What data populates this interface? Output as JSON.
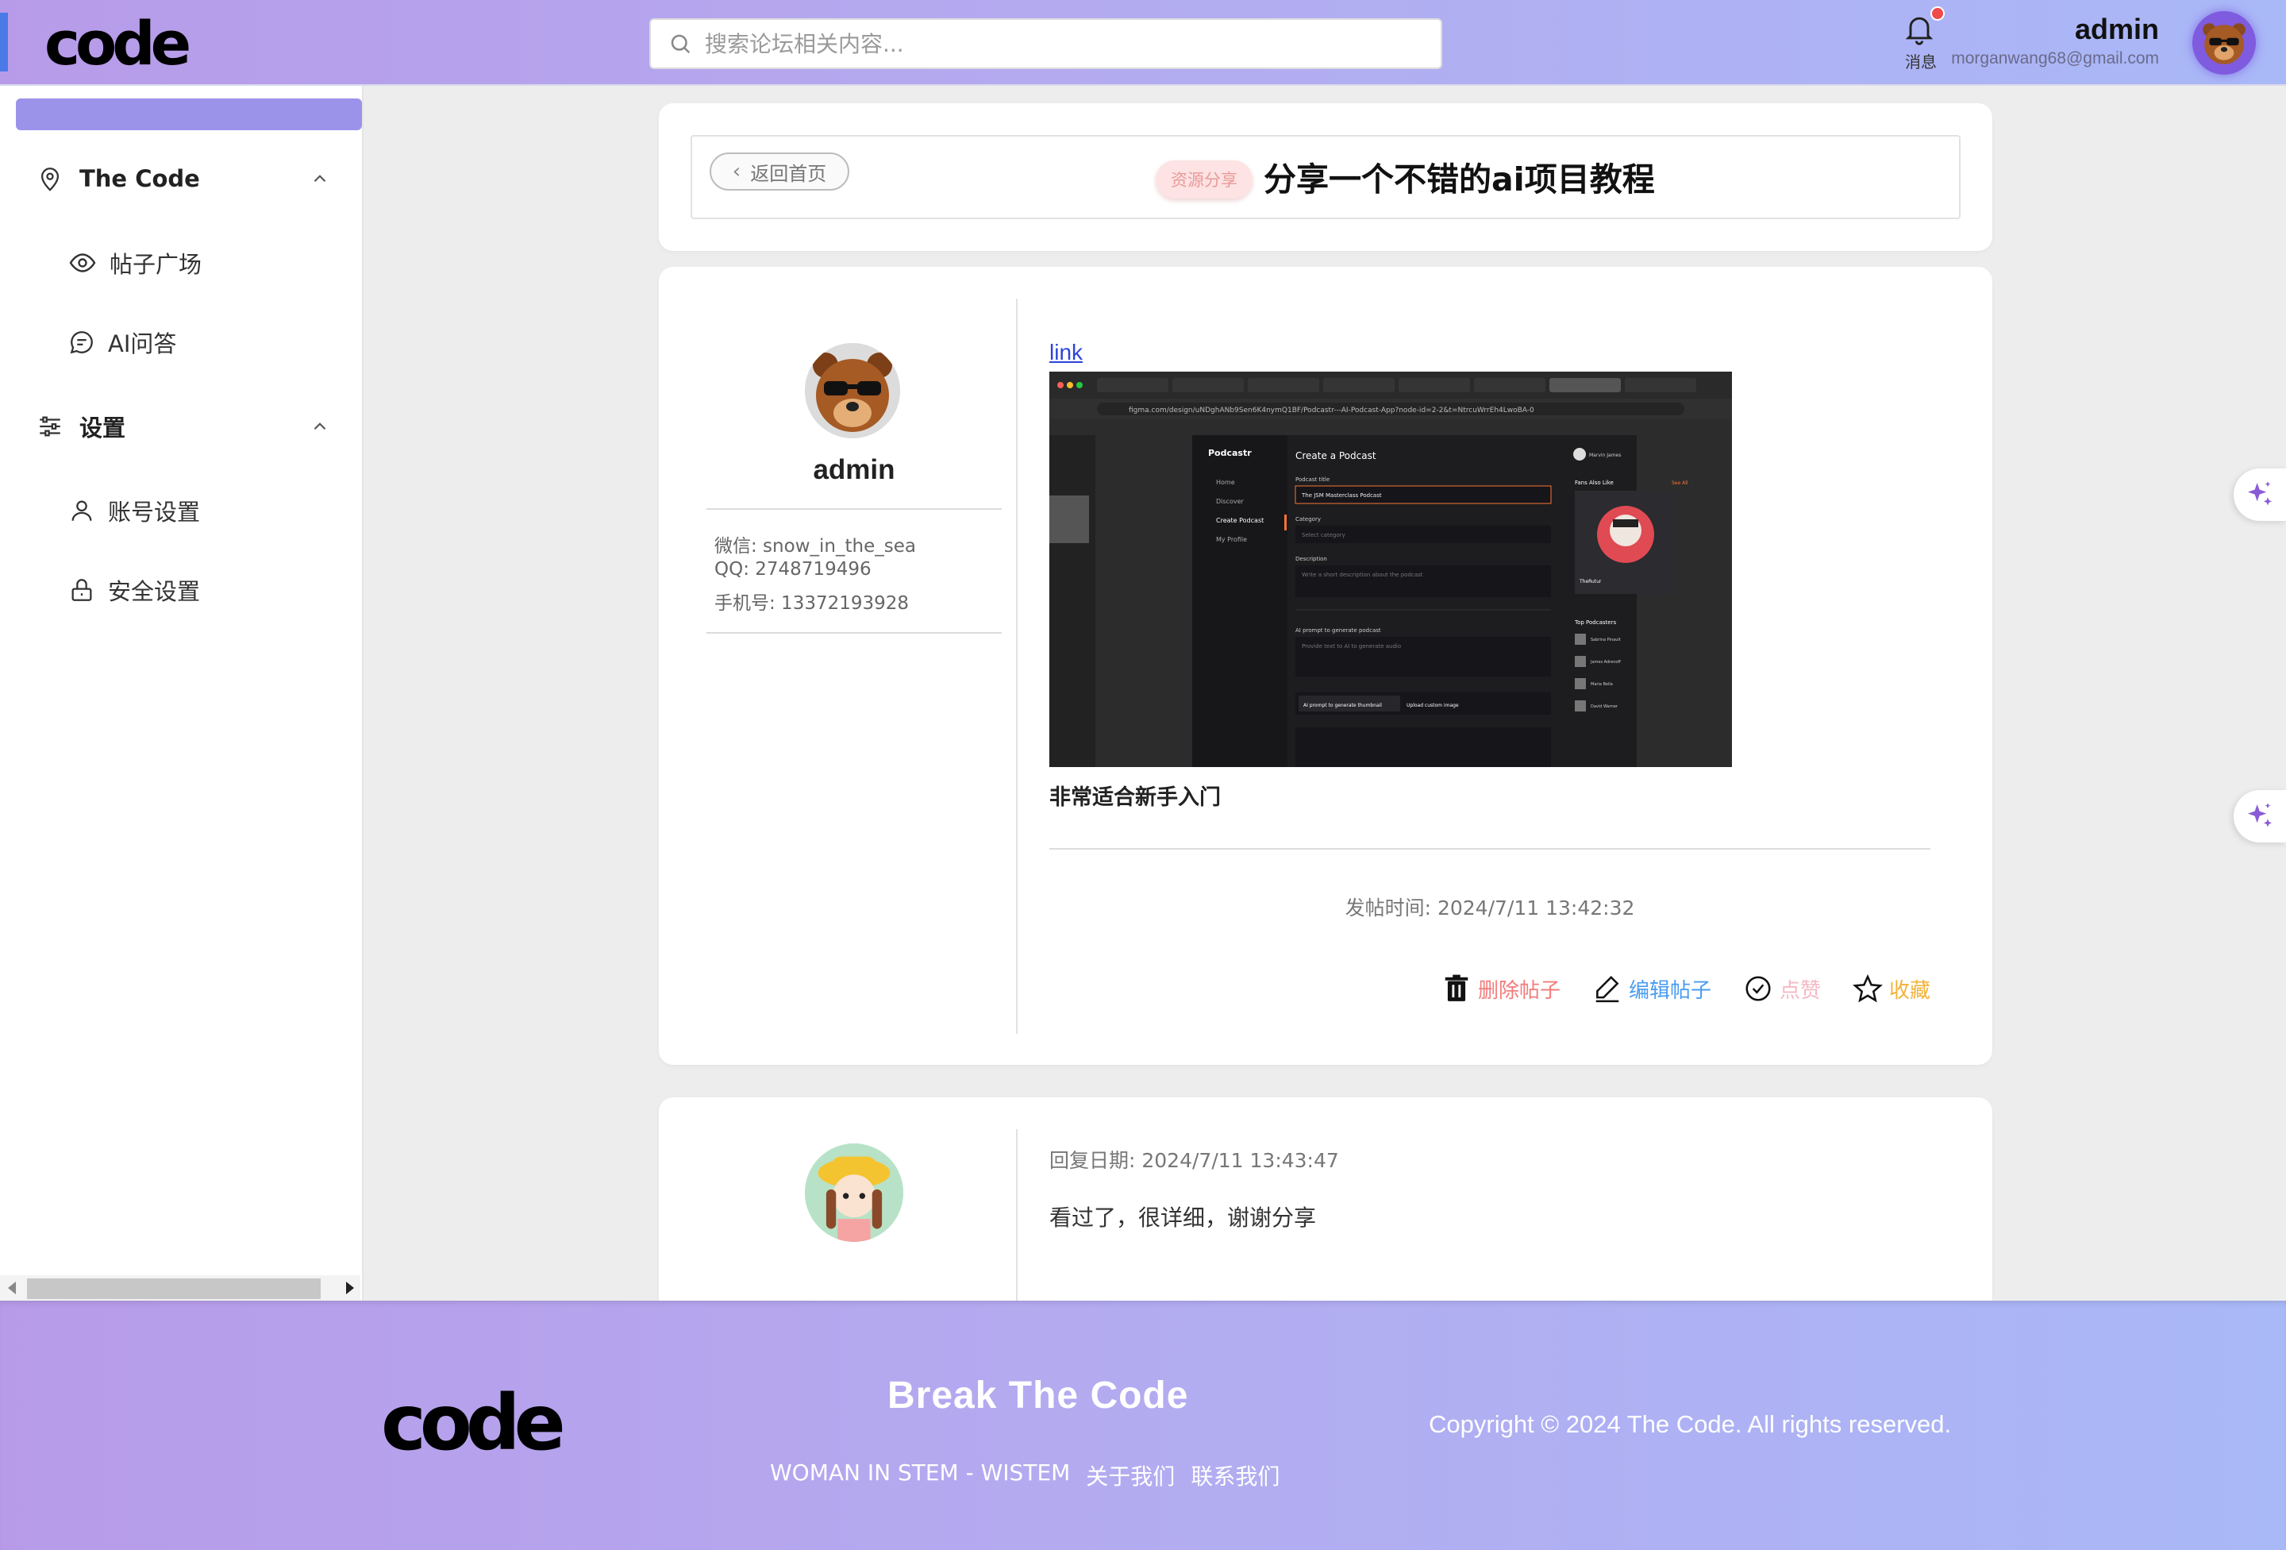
{
  "header": {
    "logo": "code",
    "search_placeholder": "搜索论坛相关内容...",
    "notif_label": "消息",
    "user_name": "admin",
    "user_email": "morganwang68@gmail.com"
  },
  "sidebar": {
    "group1": {
      "label": "The Code",
      "items": [
        "帖子广场",
        "AI问答"
      ]
    },
    "group2": {
      "label": "设置",
      "items": [
        "账号设置",
        "安全设置"
      ]
    }
  },
  "post": {
    "back_label": "返回首页",
    "tag": "资源分享",
    "title": "分享一个不错的ai项目教程",
    "author": {
      "name": "admin",
      "wechat": "微信: snow_in_the_sea",
      "qq": "QQ: 2748719496",
      "phone": "手机号: 13372193928"
    },
    "link_text": "link",
    "content": "非常适合新手入门",
    "time": "发帖时间: 2024/7/11 13:42:32",
    "actions": {
      "delete": "删除帖子",
      "edit": "编辑帖子",
      "like": "点赞",
      "favorite": "收藏"
    }
  },
  "reply": {
    "date": "回复日期: 2024/7/11 13:43:47",
    "text": "看过了，很详细，谢谢分享"
  },
  "screenshot_content": {
    "url": "figma.com/design/uNDghANb9Sen6K4nymQ1BF/Podcastr---AI-Podcast-App?node-id=2-2&t=NtrcuWrrEh4LwoBA-0",
    "brand": "Podcastr",
    "nav": [
      "Home",
      "Discover",
      "Create Podcast",
      "My Profile"
    ],
    "panel_title": "Create a Podcast",
    "field_title_label": "Podcast title",
    "field_title_value": "The JSM Masterclass Podcast",
    "field_category_label": "Category",
    "field_category_value": "Select category",
    "field_desc_label": "Description",
    "field_desc_value": "Write a short description about the podcast",
    "field_ai_label": "AI prompt to generate podcast",
    "field_ai_value": "Provide text to AI to generate audio",
    "btn1": "AI prompt to generate thumbnail",
    "btn2": "Upload custom image",
    "user": "Marvin James",
    "fans_title": "Fans Also Like",
    "see_all": "See All",
    "featured_name": "TheRutur",
    "top_title": "Top Podcasters",
    "top_list": [
      "Sabrina Pinault",
      "James Adrenoff",
      "Maria Bella",
      "David Warner"
    ]
  },
  "footer": {
    "logo": "code",
    "slogan": "Break The Code",
    "links": [
      "WOMAN IN STEM - WISTEM",
      "关于我们",
      "联系我们"
    ],
    "copyright": "Copyright © 2024 The Code. All rights reserved."
  },
  "colors": {
    "accent": "#9b93ea",
    "delete": "#f47c7c",
    "edit": "#4a9cf0",
    "like": "#f5b8c4",
    "favorite": "#f3b23a"
  }
}
